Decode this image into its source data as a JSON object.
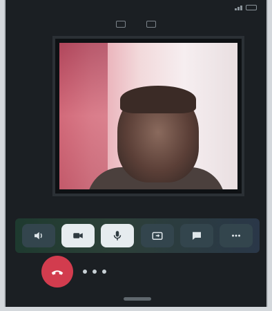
{
  "status_bar": {
    "time": "",
    "carrier": ""
  },
  "call": {
    "title": "",
    "duration": ""
  },
  "colors": {
    "end_call": "#d23c4e",
    "background": "#1b1f23"
  },
  "controls": [
    {
      "icon": "speaker-icon"
    },
    {
      "icon": "video-camera-icon"
    },
    {
      "icon": "mute-microphone-icon"
    },
    {
      "icon": "switch-camera-icon"
    },
    {
      "icon": "chat-icon"
    },
    {
      "icon": "more-icon"
    }
  ],
  "end_call_icon": "hang-up-phone-icon"
}
